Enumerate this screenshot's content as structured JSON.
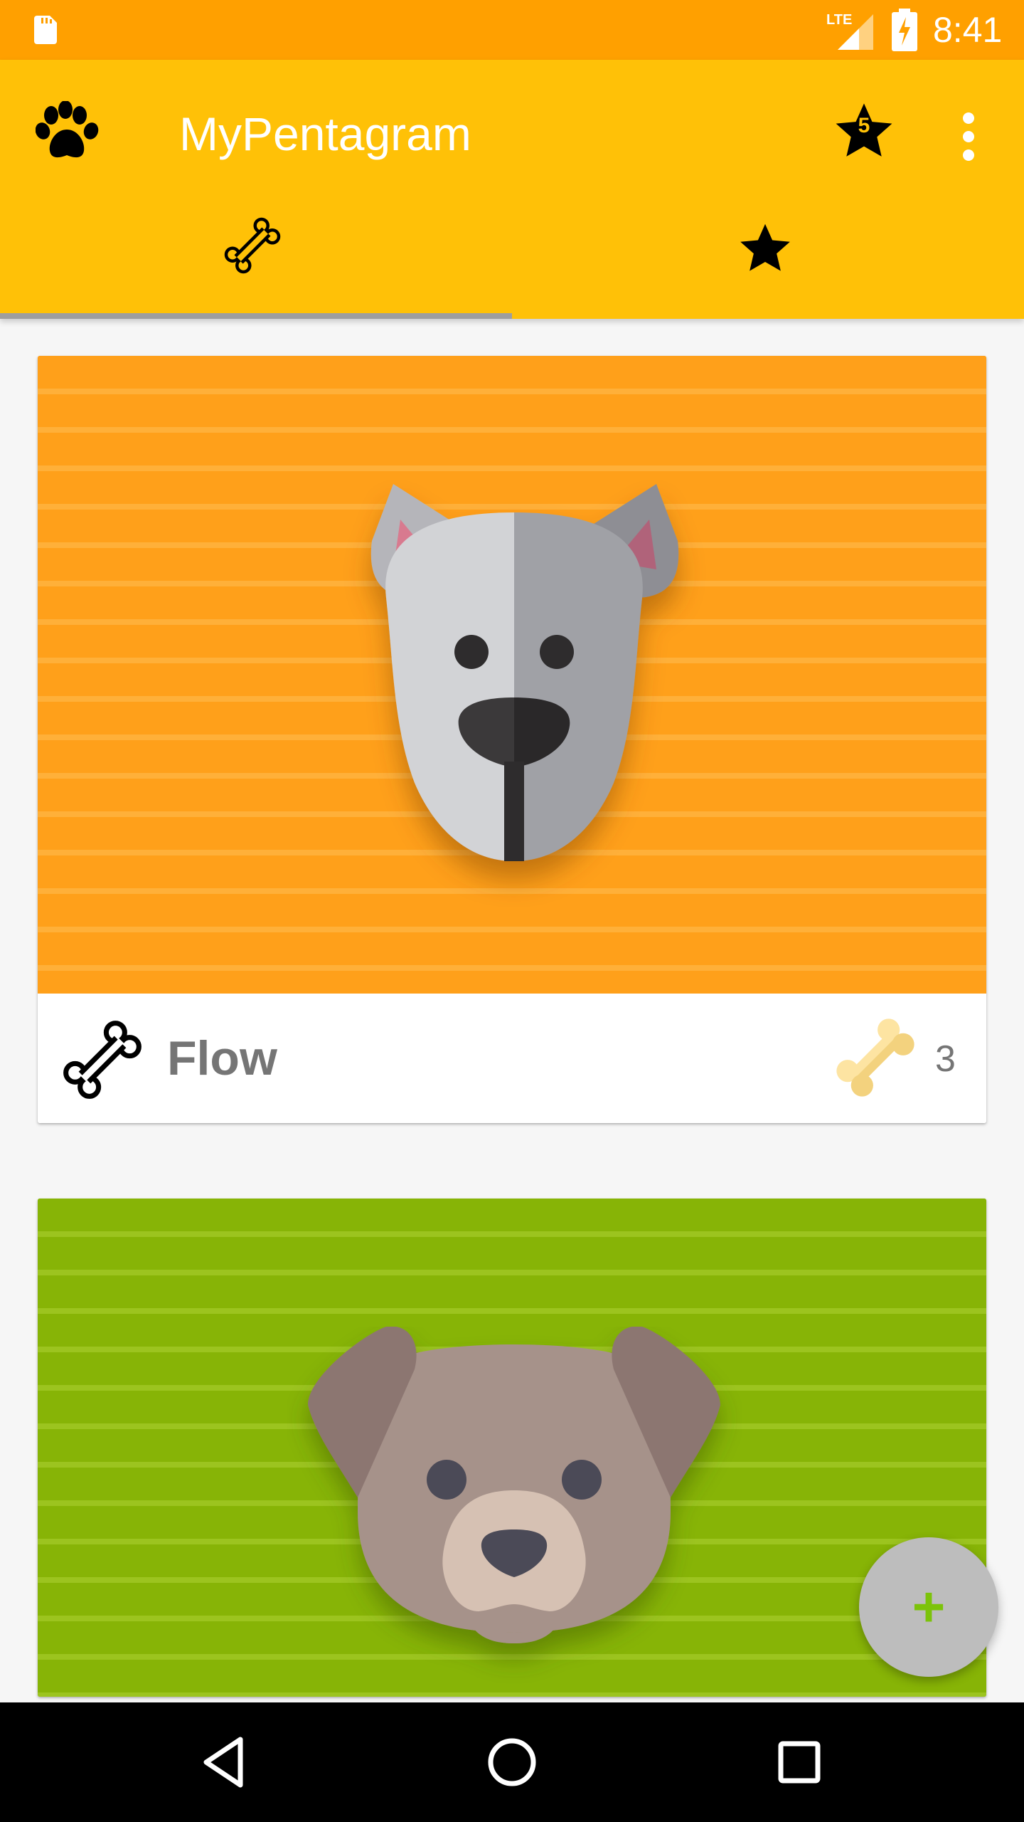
{
  "status_bar": {
    "time": "8:41",
    "network": "LTE",
    "icons": [
      "sd-card-icon",
      "lte-signal-icon",
      "battery-charging-icon"
    ]
  },
  "app_bar": {
    "title": "MyPentagram",
    "nav_icon": "paw-icon",
    "favorites_count": "5",
    "overflow_icon": "more-vert-icon",
    "colors": {
      "primary": "#ffc107",
      "status": "#ffa000"
    }
  },
  "tabs": [
    {
      "icon": "bone-icon",
      "selected": true
    },
    {
      "icon": "star-icon",
      "selected": false
    }
  ],
  "cards": [
    {
      "name": "Flow",
      "bones": "3",
      "image": "gray-dog-illustration",
      "background": "#ff9d11"
    },
    {
      "name": "",
      "bones": "",
      "image": "brown-dog-illustration",
      "background": "#86b40a"
    }
  ],
  "fab": {
    "label": "+",
    "icon": "add-icon"
  },
  "nav_bar": {
    "icons": [
      "back-icon",
      "home-icon",
      "recents-icon"
    ]
  }
}
